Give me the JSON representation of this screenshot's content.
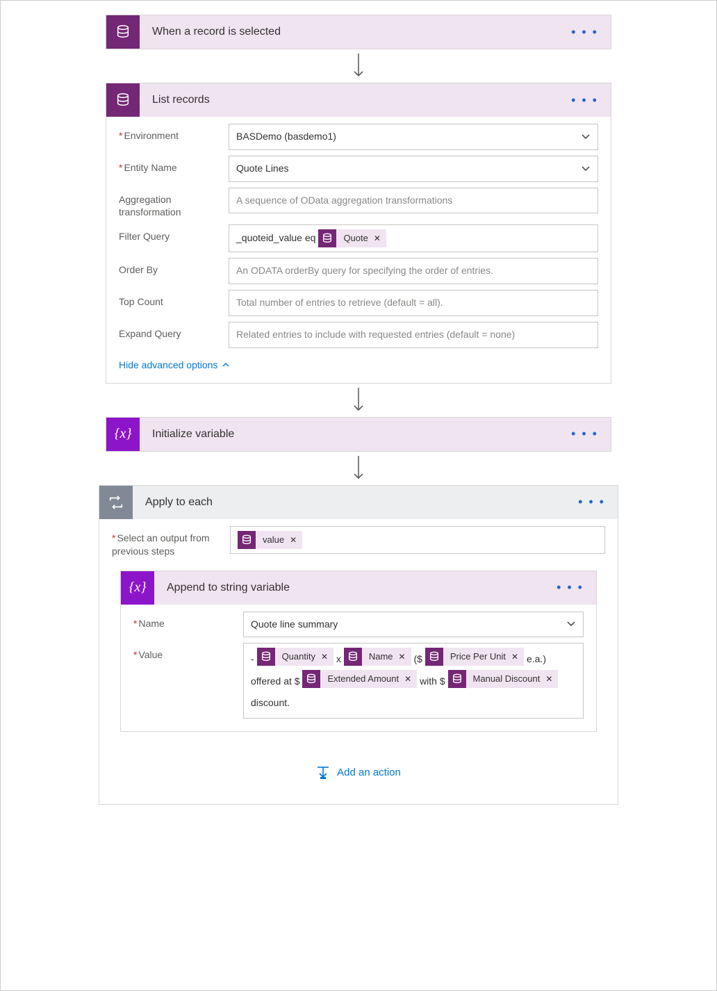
{
  "steps": {
    "trigger": {
      "title": "When a record is selected"
    },
    "list": {
      "title": "List records",
      "environment_label": "Environment",
      "environment_value": "BASDemo (basdemo1)",
      "entity_label": "Entity Name",
      "entity_value": "Quote Lines",
      "aggregation_label": "Aggregation transformation",
      "aggregation_placeholder": "A sequence of OData aggregation transformations",
      "filter_label": "Filter Query",
      "filter_prefix": "_quoteid_value eq",
      "filter_token": "Quote",
      "orderby_label": "Order By",
      "orderby_placeholder": "An ODATA orderBy query for specifying the order of entries.",
      "top_label": "Top Count",
      "top_placeholder": "Total number of entries to retrieve (default = all).",
      "expand_label": "Expand Query",
      "expand_placeholder": "Related entries to include with requested entries (default = none)",
      "hide_advanced": "Hide advanced options"
    },
    "init": {
      "title": "Initialize variable"
    },
    "apply": {
      "title": "Apply to each",
      "select_label": "Select an output from previous steps",
      "select_token": "value"
    },
    "append": {
      "title": "Append to string variable",
      "name_label": "Name",
      "name_value": "Quote line summary",
      "value_label": "Value",
      "t_dash": "-",
      "t_quantity": "Quantity",
      "t_x": "x",
      "t_name": "Name",
      "t_paren_dollar": "($",
      "t_ppu": "Price Per Unit",
      "t_ea": "e.a.)",
      "t_offered": "offered at $",
      "t_ext": "Extended Amount",
      "t_with": "with $",
      "t_manual": "Manual Discount",
      "t_discount": "discount."
    },
    "add_action": "Add an action"
  }
}
